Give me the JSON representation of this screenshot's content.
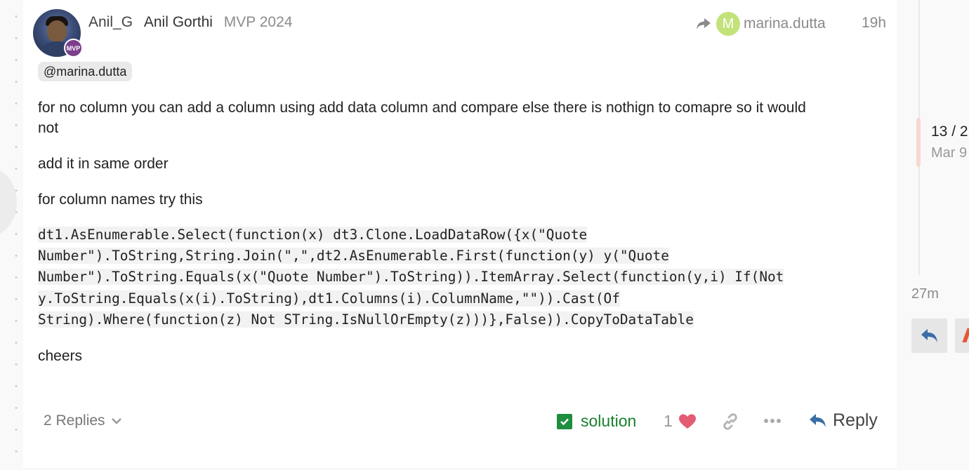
{
  "post": {
    "username": "Anil_G",
    "full_name": "Anil Gorthi",
    "user_title": "MVP 2024",
    "avatar_badge": "MVP",
    "reply_to_initial": "M",
    "reply_to_name": "marina.dutta",
    "date": "19h",
    "mention": "@marina.dutta",
    "paragraphs": [
      "for no column you can add a column using add data column and compare else there is nothign to comapre so it would",
      "not",
      "add it in same order",
      "for column names try this"
    ],
    "code_lines": [
      "dt1.AsEnumerable.Select(function(x) dt3.Clone.LoadDataRow({x(\"Quote",
      "Number\").ToString,String.Join(\",\",dt2.AsEnumerable.First(function(y) y(\"Quote",
      "Number\").ToString.Equals(x(\"Quote Number\").ToString)).ItemArray.Select(function(y,i) If(Not",
      "y.ToString.Equals(x(i).ToString),dt1.Columns(i).ColumnName,\"\")).Cast(Of",
      "String).Where(function(z) Not STring.IsNullOrEmpty(z)))},False)).CopyToDataTable"
    ],
    "closing": "cheers"
  },
  "actions": {
    "replies_label": "2 Replies",
    "solution_label": "solution",
    "like_count": "1",
    "reply_label": "Reply"
  },
  "timeline": {
    "position": "13 / 2",
    "date": "Mar 9",
    "last_activity": "27m"
  },
  "colors": {
    "accent_red": "#e45735",
    "solution_green": "#1a7f2e",
    "heart": "#e45b74",
    "mention_avatar": "#c2e27a",
    "mvp_badge": "#7b3f8c",
    "reply_blue": "#3a6ea5"
  }
}
